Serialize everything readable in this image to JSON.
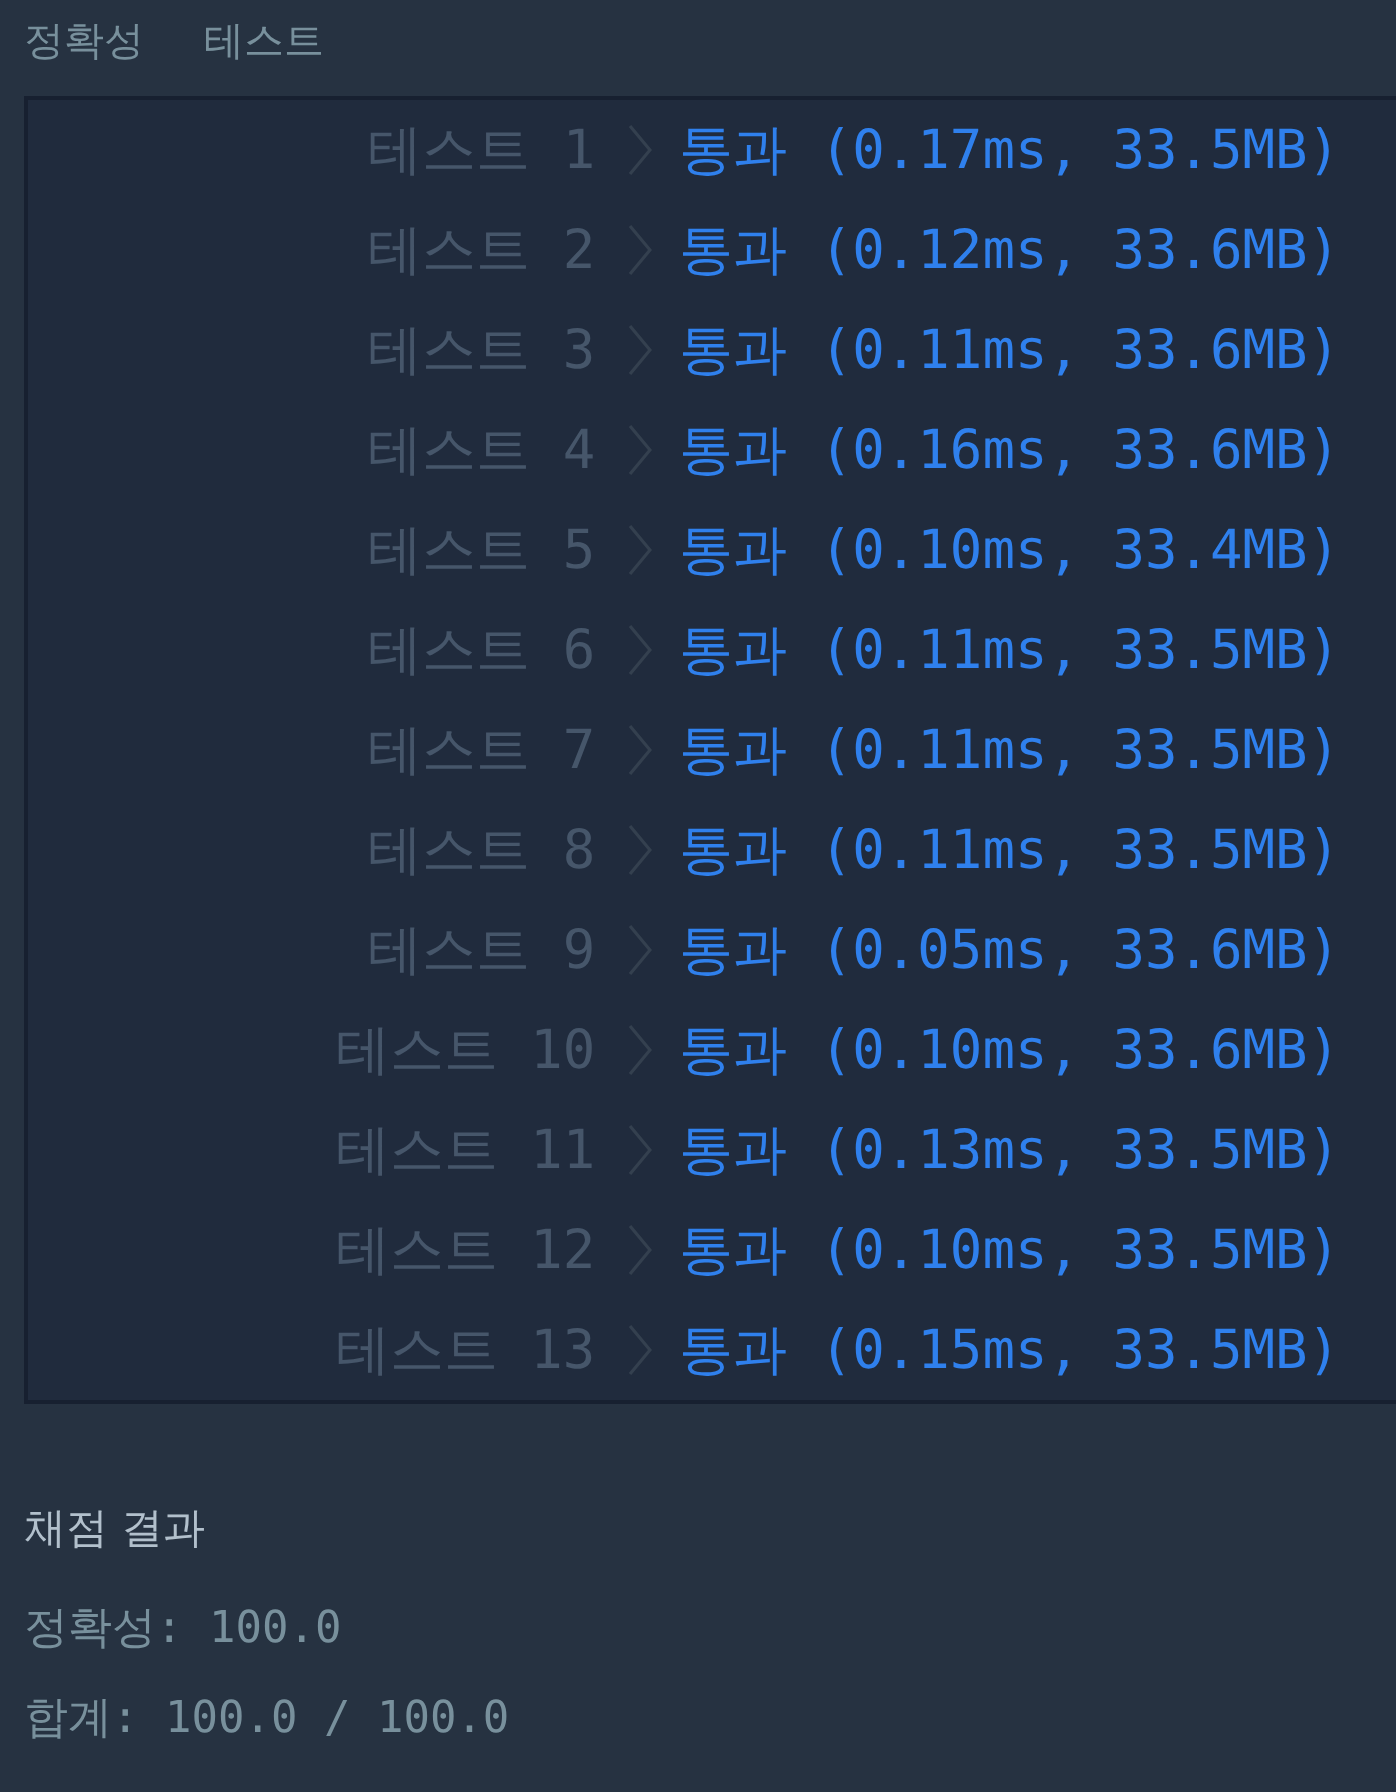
{
  "header": {
    "category": "정확성",
    "title": "테스트"
  },
  "tests": [
    {
      "label": "테스트 1",
      "result": "통과 (0.17ms, 33.5MB)",
      "passed": true
    },
    {
      "label": "테스트 2",
      "result": "통과 (0.12ms, 33.6MB)",
      "passed": true
    },
    {
      "label": "테스트 3",
      "result": "통과 (0.11ms, 33.6MB)",
      "passed": true
    },
    {
      "label": "테스트 4",
      "result": "통과 (0.16ms, 33.6MB)",
      "passed": true
    },
    {
      "label": "테스트 5",
      "result": "통과 (0.10ms, 33.4MB)",
      "passed": true
    },
    {
      "label": "테스트 6",
      "result": "통과 (0.11ms, 33.5MB)",
      "passed": true
    },
    {
      "label": "테스트 7",
      "result": "통과 (0.11ms, 33.5MB)",
      "passed": true
    },
    {
      "label": "테스트 8",
      "result": "통과 (0.11ms, 33.5MB)",
      "passed": true
    },
    {
      "label": "테스트 9",
      "result": "통과 (0.05ms, 33.6MB)",
      "passed": true
    },
    {
      "label": "테스트 10",
      "result": "통과 (0.10ms, 33.6MB)",
      "passed": true
    },
    {
      "label": "테스트 11",
      "result": "통과 (0.13ms, 33.5MB)",
      "passed": true
    },
    {
      "label": "테스트 12",
      "result": "통과 (0.10ms, 33.5MB)",
      "passed": true
    },
    {
      "label": "테스트 13",
      "result": "통과 (0.15ms, 33.5MB)",
      "passed": true
    }
  ],
  "summary": {
    "title": "채점 결과",
    "lines": [
      "정확성: 100.0",
      "합계: 100.0 / 100.0"
    ]
  }
}
